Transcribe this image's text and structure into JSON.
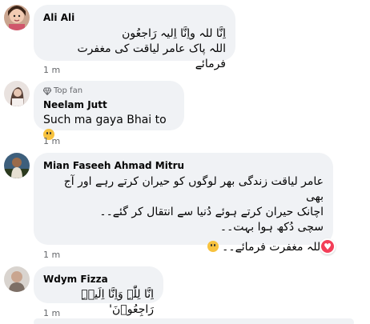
{
  "colors": {
    "bubble": "#f0f2f5",
    "meta": "#65676b",
    "heart": "#f33e58"
  },
  "comments": [
    {
      "name": "Ali Ali",
      "lines": [
        "اِنَّا للہ واِنَّا اِلیہ رَاجعُون",
        "اللہ پاک عامر لیاقت کی مغفرت فرمائے"
      ],
      "time": "1 m",
      "avatar_icon": "profile-photo"
    },
    {
      "badge": "Top fan",
      "badge_icon": "diamond-icon",
      "name": "Neelam Jutt",
      "lines": [
        "Such ma gaya Bhai to"
      ],
      "trailing_emoji": "crying-face",
      "time": "1 m",
      "avatar_icon": "profile-photo"
    },
    {
      "name": "Mian Faseeh Ahmad Mitru",
      "lines": [
        "عامر لیاقت زندگی بھر لوگوں کو حیران کرتے رہے اور آج بھی",
        "اچانک حیران کرتے ہوئے دُنیا سے انتقال کر گئے۔۔",
        "سچی دُکھ ہوا بہت۔۔",
        "",
        "اللہ مغفرت فرمائے۔۔"
      ],
      "trailing_emoji": "crying-face",
      "reaction": "heart",
      "time": "1 m",
      "avatar_icon": "profile-photo"
    },
    {
      "name": "Wdym Fizza",
      "lines": [
        "اِنَّا لِلّٰہِ وَاِنَّا اِلَیۡہِ رَاجِعُوۡنَ'"
      ],
      "time": "1 m",
      "avatar_icon": "profile-photo"
    }
  ]
}
